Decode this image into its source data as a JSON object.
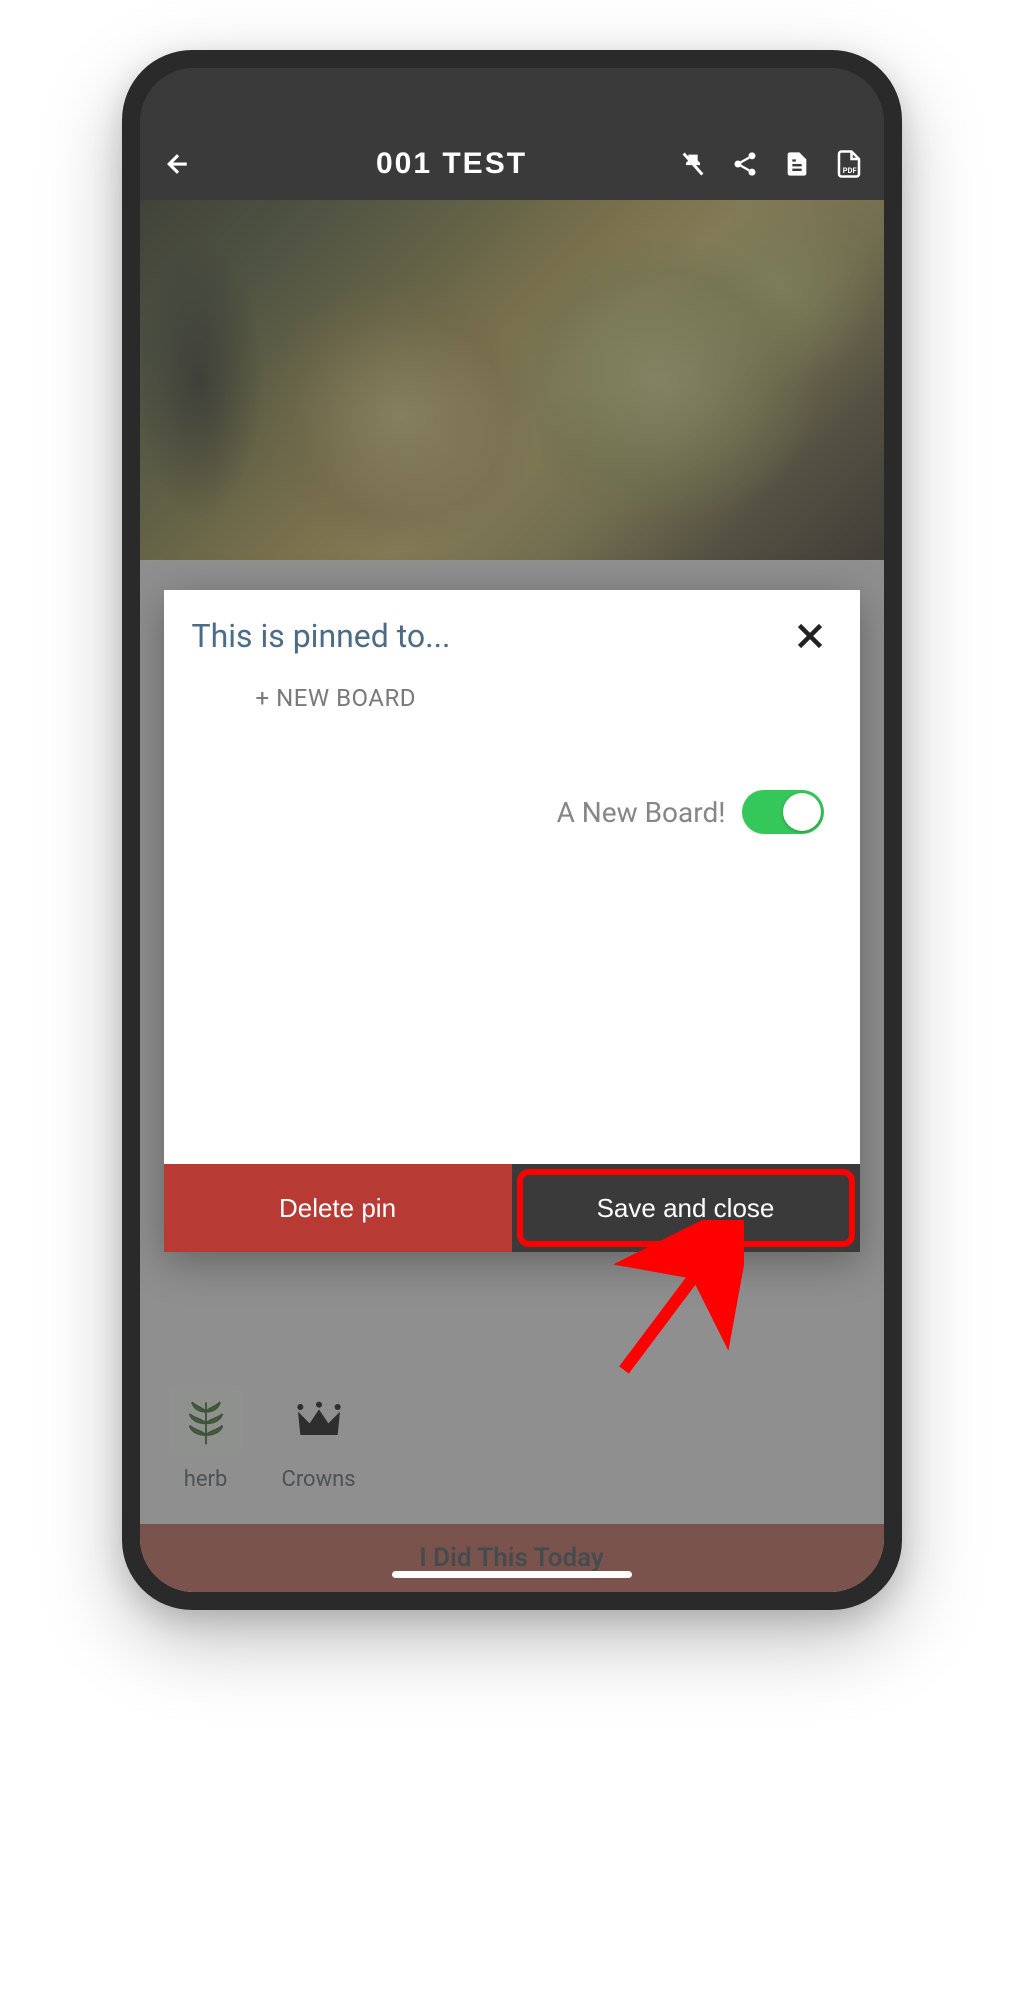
{
  "header": {
    "title": "001 TEST"
  },
  "modal": {
    "title": "This is pinned to...",
    "new_board_label": "+ NEW BOARD",
    "board_name": "A New Board!",
    "delete_label": "Delete pin",
    "save_label": "Save and close"
  },
  "tags": {
    "herb": "herb",
    "crowns": "Crowns"
  },
  "action": {
    "today_label": "I Did This Today"
  }
}
